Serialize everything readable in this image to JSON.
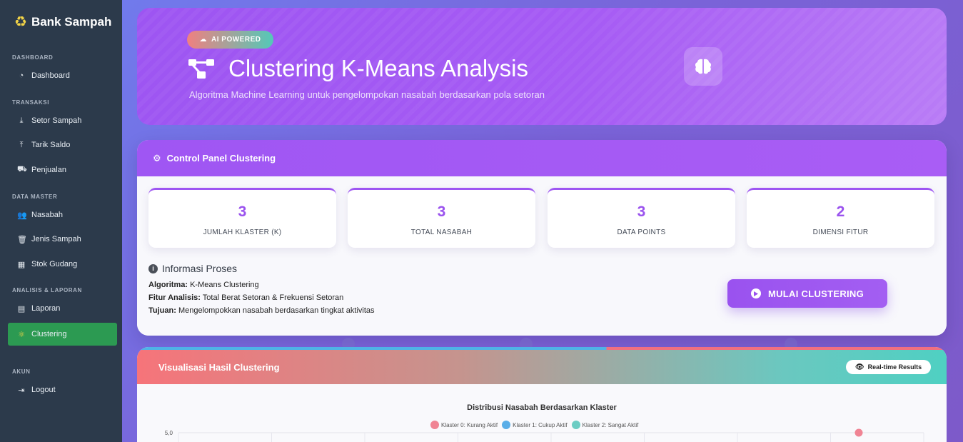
{
  "sidebar": {
    "brand": "Bank Sampah",
    "sections": {
      "dashboard": "DASHBOARD",
      "transaksi": "TRANSAKSI",
      "data_master": "DATA MASTER",
      "analisis": "ANALISIS & LAPORAN",
      "akun": "AKUN"
    },
    "items": {
      "dashboard": "Dashboard",
      "setor": "Setor Sampah",
      "tarik": "Tarik Saldo",
      "penjualan": "Penjualan",
      "nasabah": "Nasabah",
      "jenis": "Jenis Sampah",
      "stok": "Stok Gudang",
      "laporan": "Laporan",
      "clustering": "Clustering",
      "logout": "Logout"
    }
  },
  "hero": {
    "badge": "AI POWERED",
    "title": "Clustering K-Means Analysis",
    "subtitle": "Algoritma Machine Learning untuk pengelompokan nasabah berdasarkan pola setoran"
  },
  "panel": {
    "title": "Control Panel Clustering",
    "stats": [
      {
        "value": "3",
        "label": "JUMLAH KLASTER (K)"
      },
      {
        "value": "3",
        "label": "TOTAL NASABAH"
      },
      {
        "value": "3",
        "label": "DATA POINTS"
      },
      {
        "value": "2",
        "label": "DIMENSI FITUR"
      }
    ],
    "info": {
      "title": "Informasi Proses",
      "algoritma_label": "Algoritma:",
      "algoritma": "K-Means Clustering",
      "fitur_label": "Fitur Analisis:",
      "fitur": "Total Berat Setoran & Frekuensi Setoran",
      "tujuan_label": "Tujuan:",
      "tujuan": "Mengelompokkan nasabah berdasarkan tingkat aktivitas"
    },
    "start_button": "MULAI CLUSTERING"
  },
  "viz": {
    "title": "Visualisasi Hasil Clustering",
    "realtime_badge": "Real-time Results"
  },
  "chart_data": {
    "type": "scatter",
    "title": "Distribusi Nasabah Berdasarkan Klaster",
    "legend_position": "top-center",
    "series": [
      {
        "name": "Klaster 0: Kurang Aktif",
        "color": "#f08494",
        "points": [
          {
            "x": null,
            "y": 5.0
          }
        ]
      },
      {
        "name": "Klaster 1: Cukup Aktif",
        "color": "#5aaee8",
        "points": []
      },
      {
        "name": "Klaster 2: Sangat Aktif",
        "color": "#6ccdc4",
        "points": []
      }
    ],
    "y_tick_labels": [
      "5,0"
    ],
    "grid": true
  },
  "colors": {
    "accent": "#9d55f2",
    "sidebar_bg": "#2c3a4b",
    "active_nav": "#2c9a52"
  }
}
